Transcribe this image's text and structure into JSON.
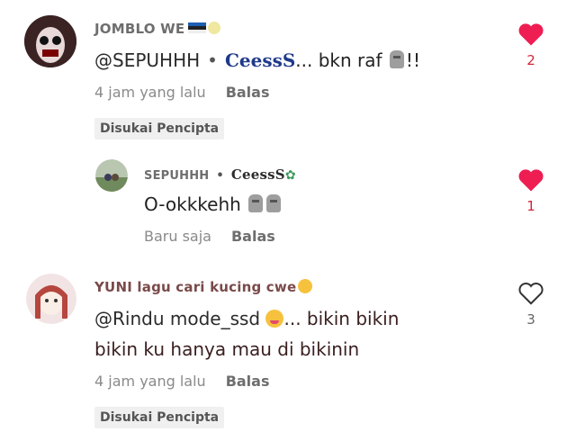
{
  "comments": [
    {
      "username": "JOMBLO WE",
      "mention": "@SEPUHHH",
      "separator": "•",
      "name_tag": "CeessS",
      "text_after": "... bkn raf",
      "exclaim": "!!",
      "time": "4 jam yang lalu",
      "reply_label": "Balas",
      "badge": "Disukai Pencipta",
      "likes": "2",
      "liked": true
    },
    {
      "username": "SEPUHHH",
      "separator": "•",
      "name_tag": "CeessS",
      "text": "O-okkkehh",
      "time": "Baru saja",
      "reply_label": "Balas",
      "likes": "1",
      "liked": true
    },
    {
      "username": "YUNI lagu cari kucing cwe",
      "mention": "@Rindu mode_ssd",
      "text_after": "... bikin bikin",
      "text_line2": "bikin ku hanya mau di bikinin",
      "time": "4 jam yang lalu",
      "reply_label": "Balas",
      "badge": "Disukai Pencipta",
      "likes": "3",
      "liked": false
    }
  ],
  "colors": {
    "heart": "#ee1d52",
    "badge_bg": "#f0f0f0"
  },
  "icons": [
    "heart-filled-icon",
    "heart-outline-icon",
    "moai-emoji",
    "flag-emoji",
    "face-emoji"
  ]
}
